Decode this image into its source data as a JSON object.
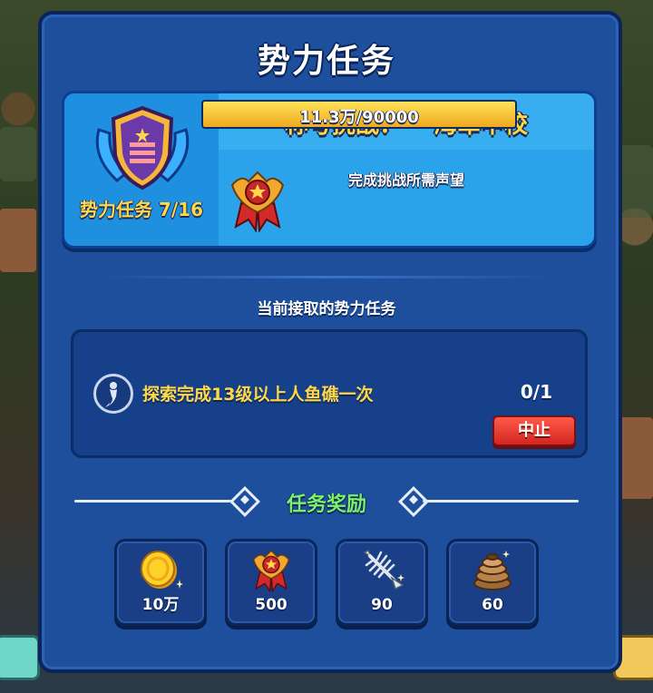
{
  "dialog": {
    "title": "势力任务"
  },
  "title_card": {
    "task_count": "势力任务 7/16",
    "challenge_label": "称号挑战：",
    "challenge_rank": "海军中校",
    "requirement_label": "完成挑战所需声望",
    "reputation_text": "11.3万/90000",
    "reputation_progress": 1.0
  },
  "current_task": {
    "section_label": "当前接取的势力任务",
    "icon": "mermaid-icon",
    "description": "探索完成13级以上人鱼礁一次",
    "progress": "0/1",
    "stop_label": "中止"
  },
  "rewards": {
    "title": "任务奖励",
    "items": [
      {
        "icon": "gold-coin-icon",
        "amount": "10万"
      },
      {
        "icon": "reputation-medal-icon",
        "amount": "500"
      },
      {
        "icon": "fish-bone-icon",
        "amount": "90"
      },
      {
        "icon": "rope-coil-icon",
        "amount": "60"
      }
    ]
  },
  "colors": {
    "panel": "#1e4f9d",
    "accent_yellow": "#ffd84a",
    "reward_title_green": "#7cf06a",
    "stop_button_red": "#d2261e"
  }
}
